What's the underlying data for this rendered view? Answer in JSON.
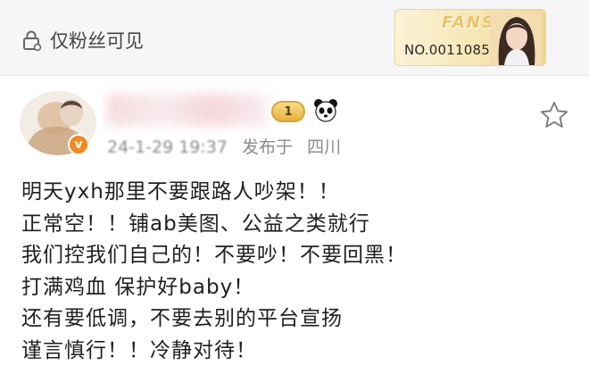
{
  "header": {
    "visibility_text": "仅粉丝可见",
    "lock_icon": "lock-icon"
  },
  "fans_card": {
    "label": "FANS",
    "number": "NO.0011085",
    "avatar_icon": "portrait-avatar"
  },
  "post": {
    "author_level": "1",
    "timestamp": "24-1-29 19:37",
    "location_prefix": "发布于",
    "location": "四川",
    "verified_icon": "verified-badge-icon",
    "panda_icon": "panda-icon",
    "favorite_icon": "star-icon",
    "lines": [
      "明天yxh那里不要跟路人吵架！！",
      "正常空！！铺ab美图、公益之类就行",
      "我们控我们自己的！不要吵！不要回黑！",
      "打满鸡血 保护好baby！",
      "还有要低调，不要去别的平台宣扬",
      "谨言慎行！！冷静对待！"
    ]
  },
  "colors": {
    "topbar_bg": "#f6f6f6",
    "fans_gold": "#e9c46a",
    "verified_orange": "#f08a24",
    "meta_gray": "#8a8a8a"
  }
}
